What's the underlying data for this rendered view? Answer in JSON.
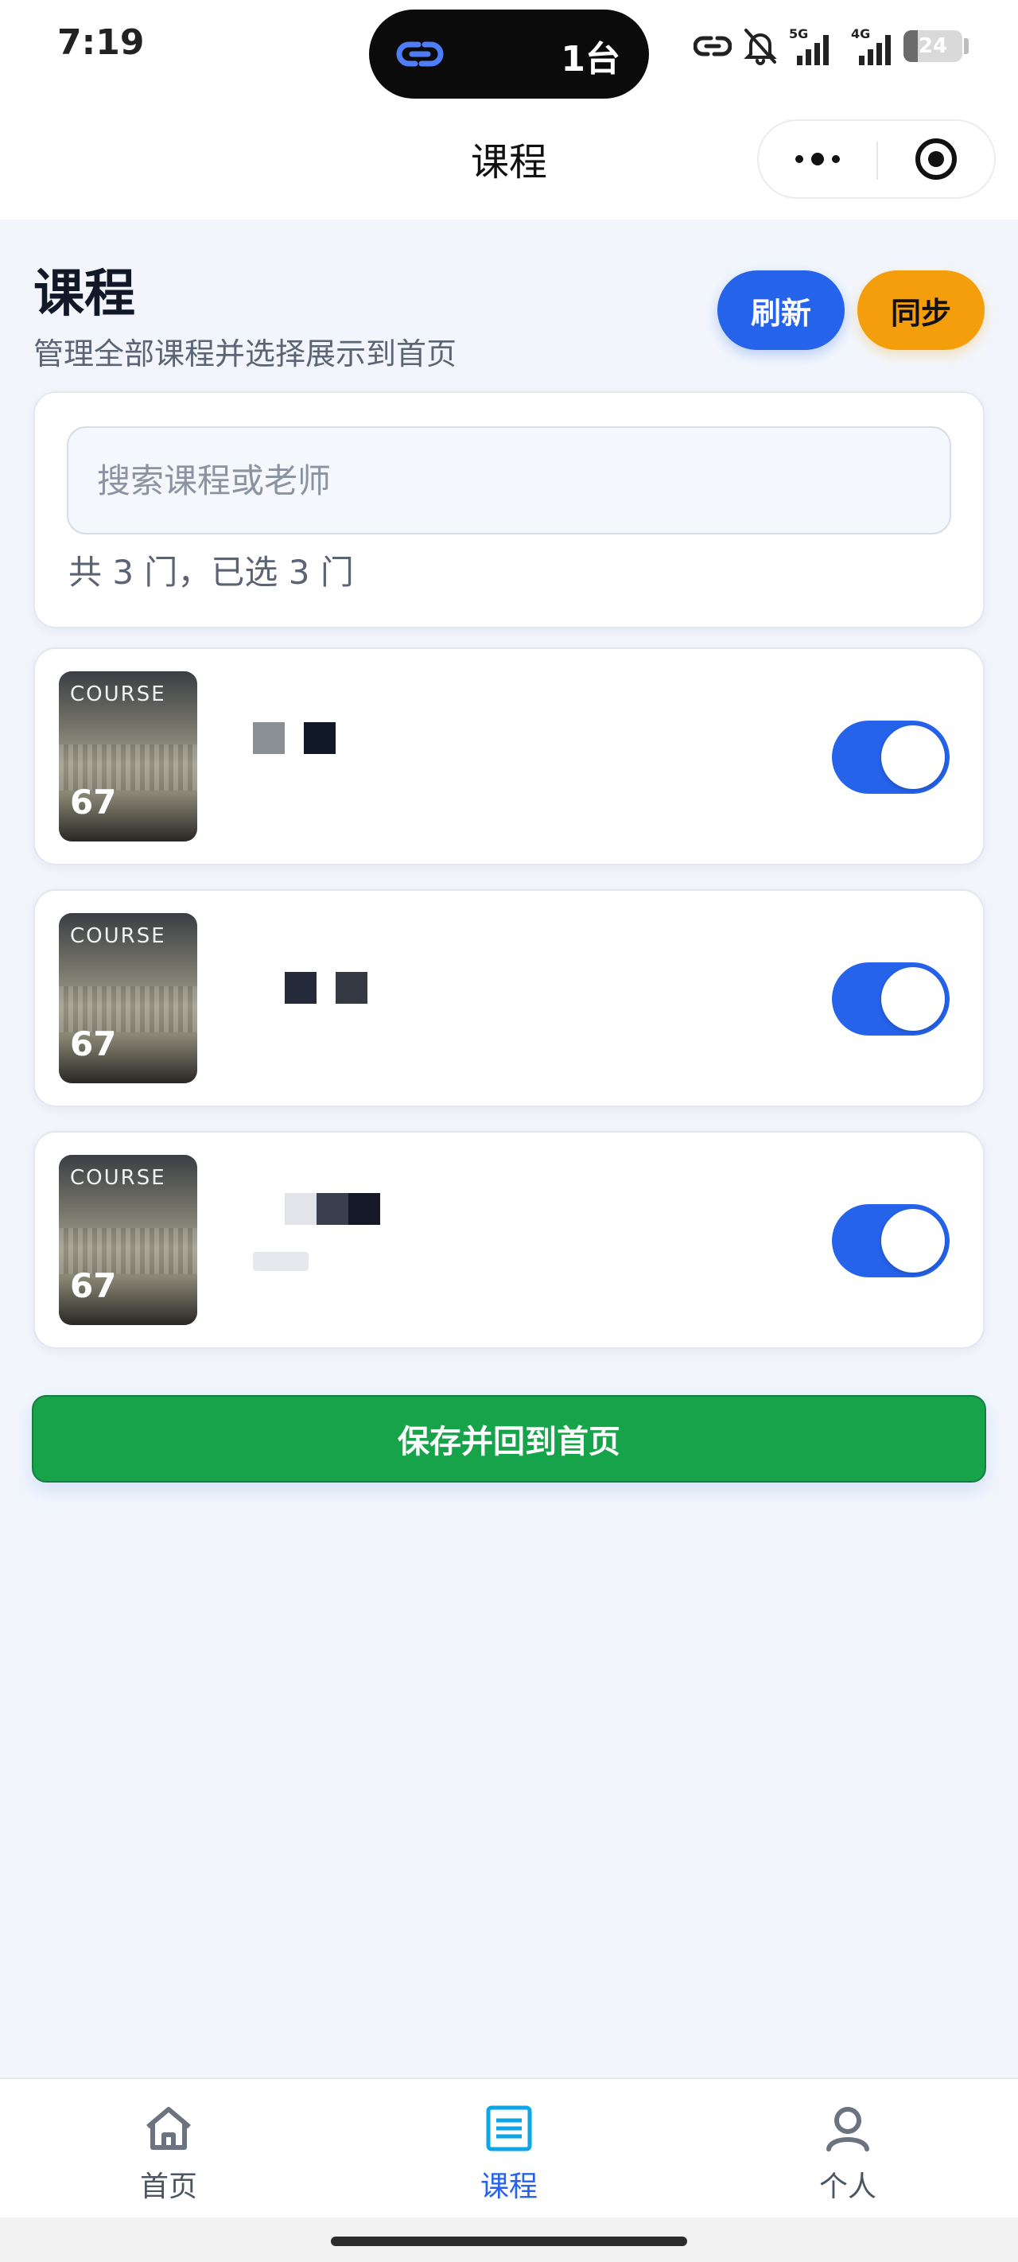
{
  "status_bar": {
    "time": "7:19",
    "island_text": "1台",
    "network_1": "5G",
    "network_2": "4G",
    "battery": "24",
    "battery_level": 0.24
  },
  "nav_bar": {
    "title": "课程"
  },
  "header": {
    "title": "课程",
    "subtitle": "管理全部课程并选择展示到首页",
    "refresh_label": "刷新",
    "sync_label": "同步"
  },
  "search": {
    "placeholder": "搜索课程或老师",
    "value": "",
    "count_text": "共 3 门，已选 3 门"
  },
  "courses": [
    {
      "thumb_label": "COURSE",
      "thumb_number": "67",
      "enabled": true
    },
    {
      "thumb_label": "COURSE",
      "thumb_number": "67",
      "enabled": true
    },
    {
      "thumb_label": "COURSE",
      "thumb_number": "67",
      "enabled": true
    }
  ],
  "save_button": "保存并回到首页",
  "tabbar": {
    "items": [
      {
        "label": "首页",
        "icon": "home-icon",
        "active": false
      },
      {
        "label": "课程",
        "icon": "list-icon",
        "active": true
      },
      {
        "label": "个人",
        "icon": "user-icon",
        "active": false
      }
    ]
  },
  "colors": {
    "primary": "#2563eb",
    "warning": "#f59e0b",
    "success": "#16a34a",
    "background": "#f2f6fc"
  }
}
